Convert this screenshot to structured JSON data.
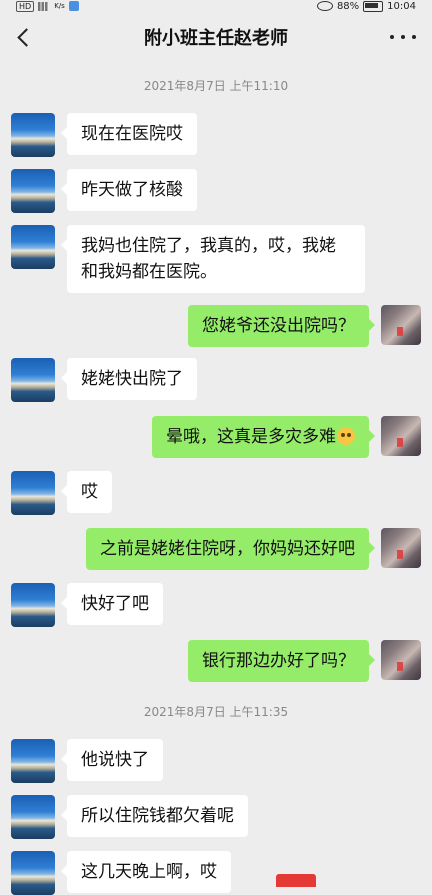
{
  "status_bar": {
    "left_badge": "HD",
    "net_speed": "K/s",
    "battery": "88%",
    "time": "10:04"
  },
  "header": {
    "title": "附小班主任赵老师"
  },
  "timestamps": [
    "2021年8月7日 上午11:10",
    "2021年8月7日 上午11:35"
  ],
  "messages": [
    {
      "side": "left",
      "text": "现在在医院哎"
    },
    {
      "side": "left",
      "text": "昨天做了核酸"
    },
    {
      "side": "left",
      "text": "我妈也住院了，我真的，哎，我姥和我妈都在医院。"
    },
    {
      "side": "right",
      "text": "您姥爷还没出院吗？"
    },
    {
      "side": "left",
      "text": "姥姥快出院了"
    },
    {
      "side": "right",
      "text": "晕哦，这真是多灾多难",
      "emoji": "flushed-face-emoji"
    },
    {
      "side": "left",
      "text": "哎"
    },
    {
      "side": "right",
      "text": "之前是姥姥住院呀，你妈妈还好吧"
    },
    {
      "side": "left",
      "text": "快好了吧"
    },
    {
      "side": "right",
      "text": "银行那边办好了吗？"
    },
    {
      "side": "left",
      "text": "他说快了"
    },
    {
      "side": "left",
      "text": "所以住院钱都欠着呢"
    },
    {
      "side": "left",
      "text": "这几天晚上啊，哎"
    }
  ],
  "icons": {
    "back": "chevron-left-icon",
    "more": "more-dots-icon"
  },
  "colors": {
    "background": "#ededed",
    "bubble_left": "#ffffff",
    "bubble_right": "#95ec69"
  }
}
